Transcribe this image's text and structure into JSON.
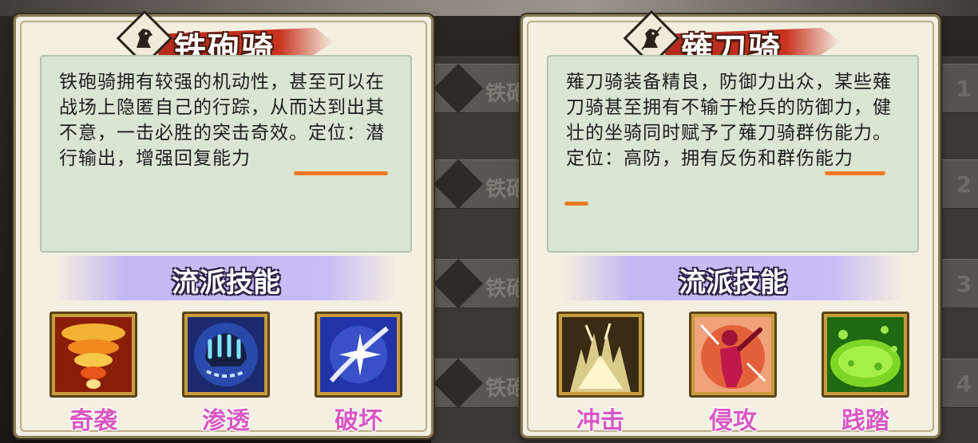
{
  "background": {
    "rows": [
      {
        "text": "铁砲",
        "num": "1"
      },
      {
        "text": "铁砲",
        "num": "2"
      },
      {
        "text": "铁砲",
        "num": "3"
      },
      {
        "text": "铁砲",
        "num": "4"
      }
    ]
  },
  "cards": [
    {
      "title": "铁砲骑",
      "description": "铁砲骑拥有较强的机动性，甚至可以在战场上隐匿自己的行踪，从而达到出其不意，一击必胜的突击奇效。定位：潜行输出，增强回复能力",
      "skills_header": "流派技能",
      "skills": [
        {
          "name": "奇袭",
          "icon": "flame-vortex-icon"
        },
        {
          "name": "渗透",
          "icon": "chained-fist-icon"
        },
        {
          "name": "破坏",
          "icon": "sparkle-slash-icon"
        }
      ]
    },
    {
      "title": "薙刀骑",
      "description": "薙刀骑装备精良，防御力出众，某些薙刀骑甚至拥有不输于枪兵的防御力，健壮的坐骑同时赋予了薙刀骑群伤能力。定位：高防，拥有反伤和群伤能力",
      "skills_header": "流派技能",
      "skills": [
        {
          "name": "冲击",
          "icon": "lightning-burst-icon"
        },
        {
          "name": "侵攻",
          "icon": "red-warrior-icon"
        },
        {
          "name": "践踏",
          "icon": "green-slime-icon"
        }
      ]
    }
  ],
  "colors": {
    "card_bg": "#f3efe1",
    "desc_bg": "#d9e6d3",
    "banner_red": "#c9321f",
    "skills_header_bg": "#c9bdf5",
    "skill_label": "#d857c1",
    "annotation_underline": "#f07a24"
  }
}
